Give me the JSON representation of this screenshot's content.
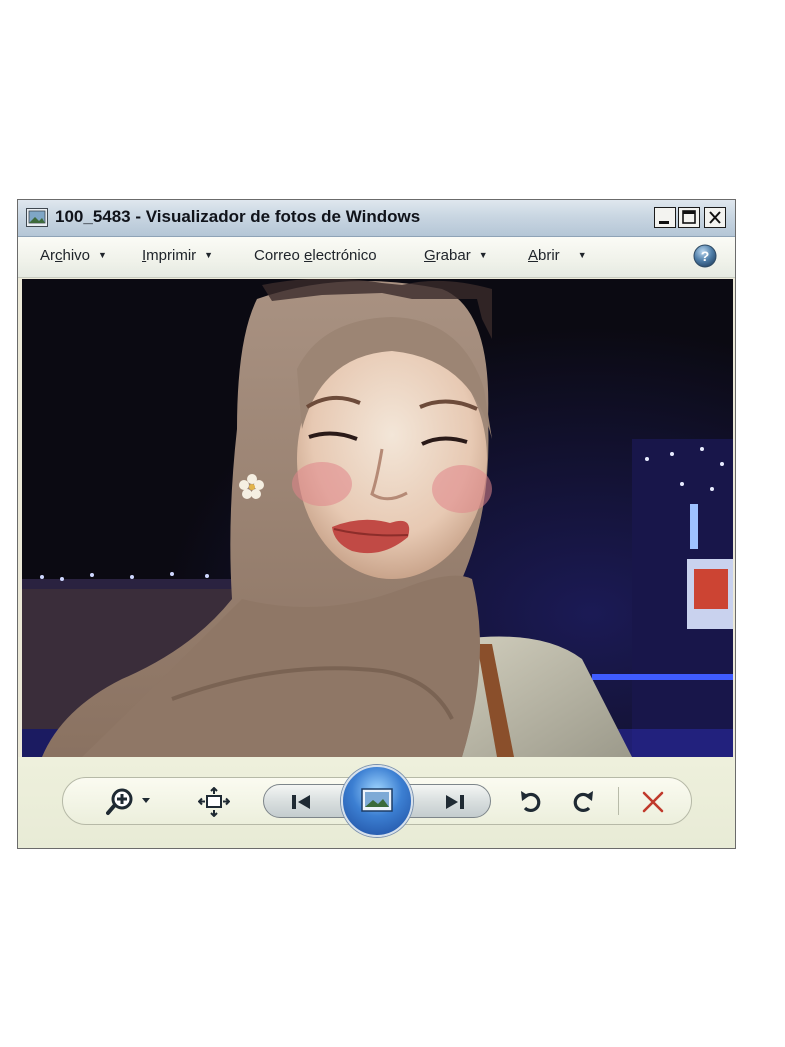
{
  "window": {
    "title": "100_5483 - Visualizador de fotos de Windows",
    "app_icon": "picture-viewer-icon"
  },
  "title_buttons": {
    "minimize": "minimize-icon",
    "maximize": "maximize-icon",
    "close": "close-icon"
  },
  "menu": {
    "items": [
      {
        "label_pre": "Ar",
        "accel": "c",
        "label_post": "hivo",
        "has_dropdown": true
      },
      {
        "label_pre": "",
        "accel": "I",
        "label_post": "mprimir",
        "has_dropdown": true
      },
      {
        "label_pre": "Correo ",
        "accel": "e",
        "label_post": "lectrónico",
        "has_dropdown": false
      },
      {
        "label_pre": "",
        "accel": "G",
        "label_post": "rabar",
        "has_dropdown": true
      },
      {
        "label_pre": "",
        "accel": "A",
        "label_post": "brir",
        "has_dropdown": true
      }
    ],
    "help_icon": "help-icon"
  },
  "photo": {
    "subject": "portrait-photo"
  },
  "toolbar": {
    "zoom": "zoom-icon",
    "fit": "actual-size-icon",
    "previous": "previous-icon",
    "slideshow": "slideshow-icon",
    "next": "next-icon",
    "rotate_ccw": "rotate-counterclockwise-icon",
    "rotate_cw": "rotate-clockwise-icon",
    "delete": "delete-icon",
    "delete_color": "#c0392b",
    "accent_color": "#3c7fd2"
  }
}
